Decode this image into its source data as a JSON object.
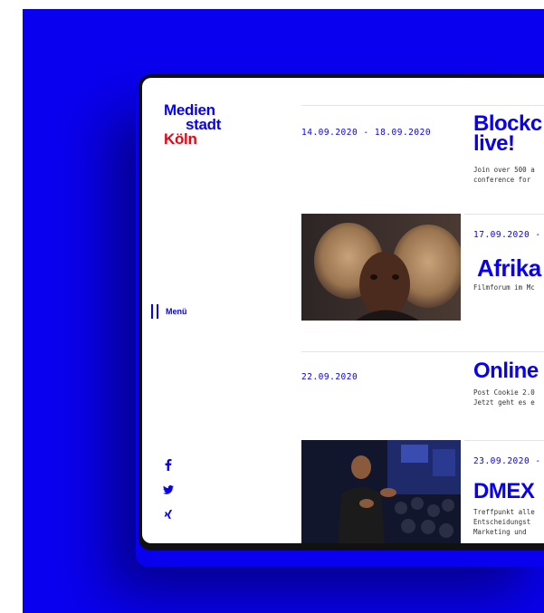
{
  "logo": {
    "line1": "Medien",
    "line2": "stadt",
    "line3": "Köln"
  },
  "menu": {
    "label": "Menü"
  },
  "social": [
    "facebook-icon",
    "twitter-icon",
    "xing-icon"
  ],
  "social_glyphs": {
    "facebook": "f",
    "twitter": "✓",
    "xing": "✕"
  },
  "events": [
    {
      "date": "14.09.2020 - 18.09.2020",
      "title_line1": "Blockc",
      "title_line2": "live!",
      "desc_line1": "Join over 500 a",
      "desc_line2": "conference for"
    },
    {
      "date": "17.09.2020 -",
      "title": "Afrika",
      "desc_line1": "Filmforum im Mc"
    },
    {
      "date": "22.09.2020",
      "title": "Online",
      "desc_line1": "Post Cookie 2.0",
      "desc_line2": "Jetzt geht es e"
    },
    {
      "date": "23.09.2020 -",
      "title": "DMEX",
      "desc_line1": "Treffpunkt alle",
      "desc_line2": "Entscheidungst",
      "desc_line3": "Marketing und"
    }
  ],
  "colors": {
    "brand_blue": "#0a00f0",
    "brand_red": "#e30613",
    "background": "#0a00f0"
  }
}
